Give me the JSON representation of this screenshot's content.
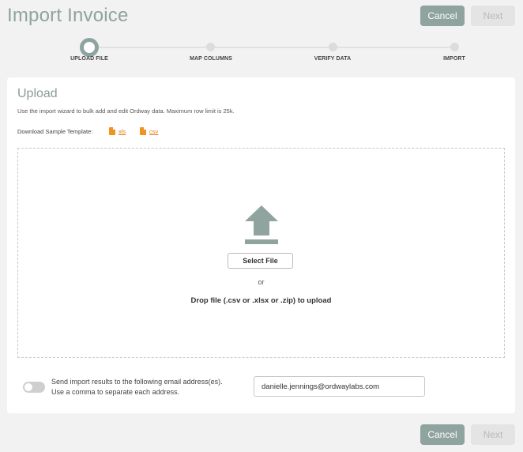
{
  "header": {
    "title": "Import Invoice",
    "cancel_label": "Cancel",
    "next_label": "Next"
  },
  "stepper": {
    "steps": [
      {
        "label": "UPLOAD FILE",
        "active": true
      },
      {
        "label": "MAP COLUMNS",
        "active": false
      },
      {
        "label": "VERIFY DATA",
        "active": false
      },
      {
        "label": "IMPORT",
        "active": false
      }
    ]
  },
  "upload": {
    "title": "Upload",
    "description": "Use the import wizard to bulk add and edit Ordway data. Maximum row limit is 25k.",
    "template_label": "Download Sample Template:",
    "templates": [
      {
        "label": "xls",
        "icon": "excel-file-icon"
      },
      {
        "label": "csv",
        "icon": "csv-file-icon"
      }
    ],
    "dropzone": {
      "icon": "upload-arrow-icon",
      "select_label": "Select File",
      "or_text": "or",
      "drop_text": "Drop file (.csv or .xlsx or .zip) to upload"
    },
    "email": {
      "toggle_on": false,
      "label_line1": "Send import results to the following email address(es).",
      "label_line2": "Use a comma to separate each address.",
      "value": "danielle.jennings@ordwaylabs.com"
    }
  },
  "footer": {
    "cancel_label": "Cancel",
    "next_label": "Next"
  },
  "colors": {
    "accent": "#8fa39f",
    "link": "#e47911",
    "disabled_bg": "#e4e4e4"
  }
}
